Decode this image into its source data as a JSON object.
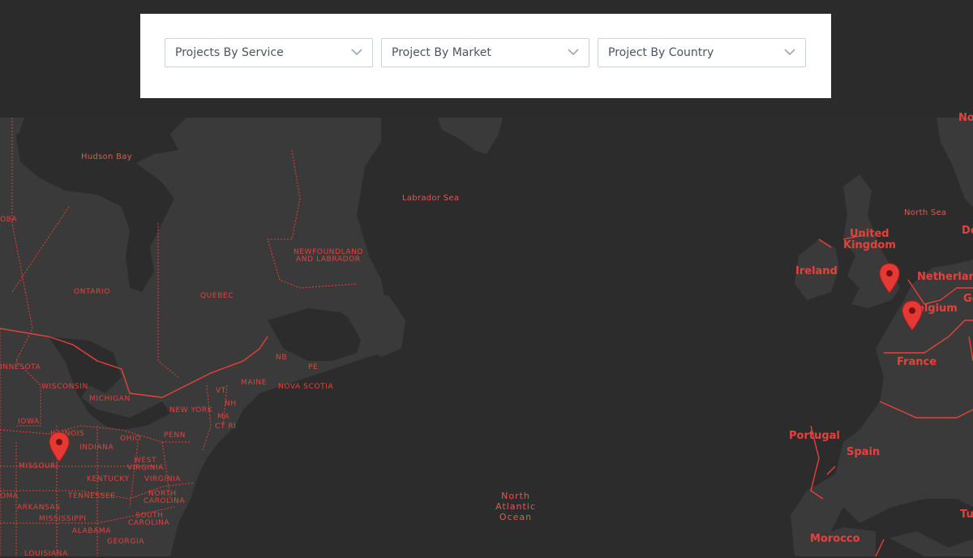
{
  "filters": {
    "service": {
      "label": "Projects By Service"
    },
    "market": {
      "label": "Project By Market"
    },
    "country": {
      "label": "Project By Country"
    }
  },
  "map": {
    "water_labels": {
      "hudson_bay": "Hudson Bay",
      "labrador_sea": "Labrador Sea",
      "north_sea": "North Sea",
      "north_atlantic_1": "North",
      "north_atlantic_2": "Atlantic",
      "north_atlantic_3": "Ocean"
    },
    "region_labels": {
      "manitoba": "OBA",
      "ontario": "ONTARIO",
      "quebec": "QUEBEC",
      "newfoundland_1": "NEWFOUNDLAND",
      "newfoundland_2": "AND LABRADOR",
      "nb": "NB",
      "pe": "PE",
      "nova_scotia": "NOVA SCOTIA",
      "maine": "MAINE",
      "vt": "VT",
      "nh": "NH",
      "ma": "MA",
      "ct_ri": "CT RI",
      "new_york": "NEW YORK",
      "minnesota": "INNESOTA",
      "wisconsin": "WISCONSIN",
      "michigan": "MICHIGAN",
      "iowa": "IOWA",
      "illinois": "ILLINOIS",
      "indiana": "INDIANA",
      "ohio": "OHIO",
      "penn": "PENN",
      "missouri": "MISSOURI",
      "west_virginia_1": "WEST",
      "west_virginia_2": "VIRGINIA",
      "virginia": "VIRGINIA",
      "kentucky": "KENTUCKY",
      "tennessee": "TENNESSEE",
      "north_carolina_1": "NORTH",
      "north_carolina_2": "CAROLINA",
      "south_carolina_1": "SOUTH",
      "south_carolina_2": "CAROLINA",
      "oklahoma": "OMA",
      "arkansas": "ARKANSAS",
      "mississippi": "MISSISSIPPI",
      "alabama": "ALABAMA",
      "georgia": "GEORGIA",
      "louisiana": "LOUISIANA"
    },
    "country_labels": {
      "ireland": "Ireland",
      "uk_1": "United",
      "uk_2": "Kingdom",
      "netherlands": "Netherland",
      "belgium": "elgium",
      "germany": "Ge",
      "denmark": "De",
      "norway": "No",
      "france": "France",
      "portugal": "Portugal",
      "spain": "Spain",
      "morocco": "Morocco",
      "tunisia": "Tu"
    },
    "markers": [
      {
        "name": "missouri-illinois"
      },
      {
        "name": "united-kingdom"
      },
      {
        "name": "belgium-france"
      }
    ],
    "colors": {
      "water": "#2c2c2c",
      "land": "#3a3a3a",
      "border": "#e8413b",
      "marker": "#e53935"
    }
  }
}
